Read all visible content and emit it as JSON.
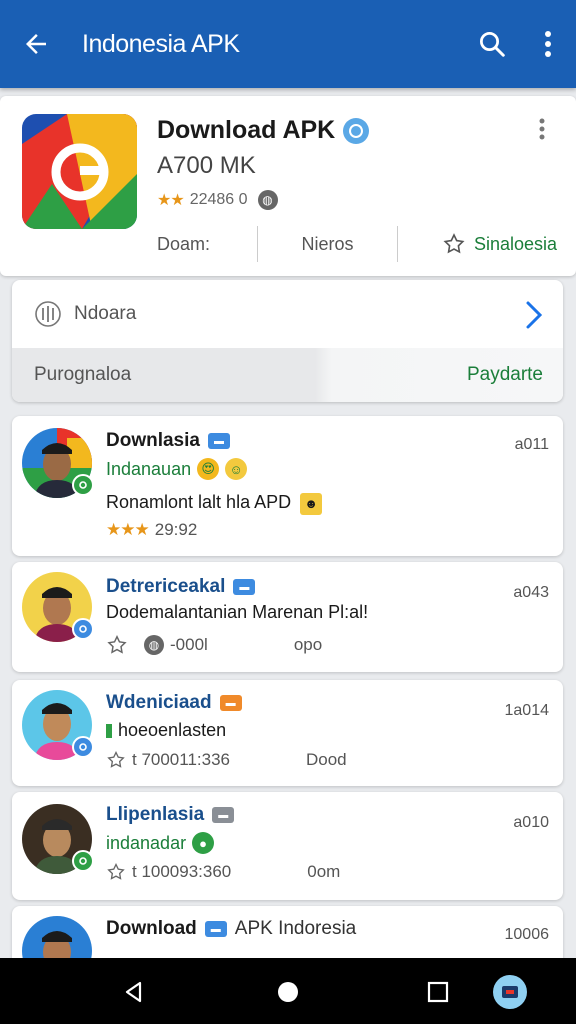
{
  "appbar": {
    "title": "Indonesia APK",
    "back_icon": "arrow-left-icon",
    "search_icon": "search-icon",
    "more_icon": "more-vertical-icon",
    "color": "#1a5fb4"
  },
  "app": {
    "name": "Download APK",
    "size": "A700 MK",
    "stars": "★★",
    "rating_count": "22486 0",
    "stats": [
      "Doam:",
      "Nieros",
      "Sinaloesia"
    ]
  },
  "info": {
    "label": "Ndoara",
    "left_text": "Purognaloa",
    "right_text": "Paydarte"
  },
  "feed": [
    {
      "name": "Downlasia",
      "sub": "Indanauan",
      "body": "Ronamlont lalt hla APD",
      "stars": "★★★",
      "rating": "29:92",
      "time": "a011"
    },
    {
      "name": "Detrericeakal",
      "sub": "",
      "body": "Dodemalantanian Marenan Pl:al!",
      "meta_1": "-000l",
      "meta_2": "opo",
      "time": "a043"
    },
    {
      "name": "Wdeniciaad",
      "sub": "hoeoenlasten",
      "body": "",
      "meta_1": "t 700011:336",
      "meta_2": "Dood",
      "time": "1a014"
    },
    {
      "name": "Llipenlasia",
      "sub": "indanadar",
      "body": "",
      "meta_1": "t 100093:360",
      "meta_2": "0om",
      "time": "a010"
    },
    {
      "name": "Download",
      "name_suffix": "APK Indoresia",
      "sub": "",
      "body": "",
      "time": "10006"
    }
  ],
  "colors": {
    "accent_blue": "#1a5fb4",
    "green": "#1b7e3a",
    "star": "#e7961a"
  }
}
